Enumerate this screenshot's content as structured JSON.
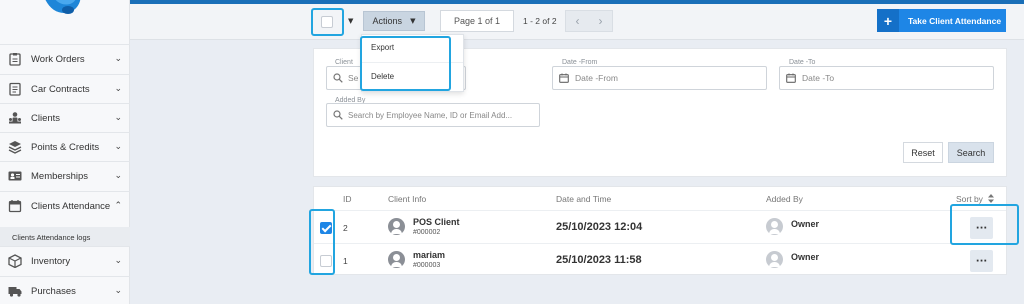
{
  "sidebar": {
    "items": [
      {
        "label": "Work Orders",
        "icon": "clipboard-icon",
        "chevron": "⌄"
      },
      {
        "label": "Car Contracts",
        "icon": "document-icon",
        "chevron": "⌄"
      },
      {
        "label": "Clients",
        "icon": "people-icon",
        "chevron": "⌄"
      },
      {
        "label": "Points & Credits",
        "icon": "layers-icon",
        "chevron": "⌄"
      },
      {
        "label": "Memberships",
        "icon": "id-card-icon",
        "chevron": "⌄"
      },
      {
        "label": "Clients Attendance",
        "icon": "calendar-icon",
        "chevron": "⌃"
      },
      {
        "label": "Inventory",
        "icon": "box-icon",
        "chevron": "⌄"
      },
      {
        "label": "Purchases",
        "icon": "truck-icon",
        "chevron": "⌄"
      }
    ],
    "sub_item": "Clients Attendance logs"
  },
  "toolbar": {
    "actions_label": "Actions",
    "pagination_label": "Page 1 of 1",
    "range_label": "1 - 2 of 2",
    "prev": "‹",
    "next": "›",
    "take_attendance_label": "Take Client Attendance",
    "take_attendance_icon": "+"
  },
  "actions_menu": {
    "items": [
      "Export",
      "Delete"
    ]
  },
  "filters": {
    "client_label": "Client",
    "client_placeholder": "Se",
    "date_from_label": "Date -From",
    "date_from_placeholder": "Date -From",
    "date_to_label": "Date -To",
    "date_to_placeholder": "Date -To",
    "added_by_label": "Added By",
    "added_by_placeholder": "Search by Employee Name, ID or Email Add...",
    "reset_label": "Reset",
    "search_label": "Search"
  },
  "table": {
    "headers": {
      "id": "ID",
      "client": "Client Info",
      "datetime": "Date and Time",
      "added_by": "Added By",
      "sort": "Sort by"
    },
    "rows": [
      {
        "checked": true,
        "id": "2",
        "client_name": "POS Client",
        "client_no": "#000002",
        "datetime": "25/10/2023 12:04",
        "added_by": "Owner",
        "menu": "···"
      },
      {
        "checked": false,
        "id": "1",
        "client_name": "mariam",
        "client_no": "#000003",
        "datetime": "25/10/2023 11:58",
        "added_by": "Owner",
        "menu": "···"
      }
    ]
  },
  "colors": {
    "primary": "#1e86e6",
    "highlight": "#22a5e0",
    "topbar": "#1a6fb8"
  }
}
